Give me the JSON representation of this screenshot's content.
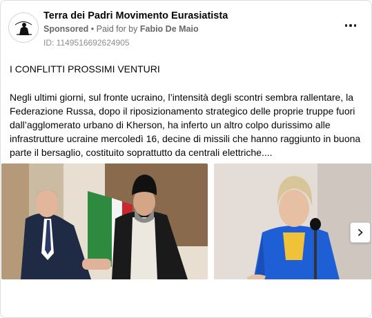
{
  "post": {
    "page_name": "Terra dei Padri Movimento Eurasiatista",
    "sponsored_label": "Sponsored",
    "meta_separator": " • ",
    "paid_for_label": "Paid for by ",
    "payer": "Fabio De Maio",
    "ad_id": "ID: 1149516692624905",
    "headline": "I CONFLITTI PROSSIMI VENTURI",
    "body": "Negli ultimi giorni, sul fronte ucraino, l’intensità degli scontri sembra rallentare, la Federazione Russa, dopo il riposizionamento strategico delle proprie truppe fuori dall’agglomerato urbano di Kherson, ha inferto un altro colpo durissimo alle infrastrutture ucraine mercoledì 16, decine di missili che hanno raggiunto in buona parte il bersaglio, costituito soprattutto da centrali elettriche...."
  },
  "icons": {
    "more": "more-horizontal-icon",
    "next": "chevron-right-icon"
  },
  "colors": {
    "meta_text": "#65676b",
    "border": "#dadde1",
    "blue_suit": "#1f5fd6"
  }
}
